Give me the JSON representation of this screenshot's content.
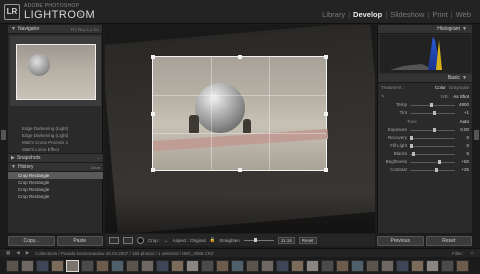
{
  "app": {
    "brand_small": "ADOBE PHOTOSHOP",
    "brand_big": "LIGHTROOM",
    "version": "3",
    "logo": "LR"
  },
  "modules": [
    "Library",
    "Develop",
    "Slideshow",
    "Print",
    "Web"
  ],
  "active_module": "Develop",
  "left_panel": {
    "navigator_title": "Navigator",
    "navigator_zoom": [
      "FIT",
      "FILL",
      "1:1",
      "3:1"
    ],
    "presets": [
      "Edge Darkening (Light)",
      "Edge Darkening (Light)",
      "Matt's Cross Process 1",
      "Matt's Lomo Effect"
    ],
    "snapshots_title": "Snapshots",
    "history_title": "History",
    "history_clear": "Clear",
    "history_items": [
      "Crop Rectangle",
      "Crop Rectangle",
      "Crop Rectangle",
      "Crop Rectangle"
    ],
    "copy_label": "Copy...",
    "paste_label": "Paste"
  },
  "right_panel": {
    "histogram_title": "Histogram",
    "basic_title": "Basic",
    "treatment_label": "Treatment :",
    "treatment_color": "Color",
    "treatment_gray": "Grayscale",
    "wb_label": "WB :",
    "wb_value": "As Shot",
    "temp_label": "Temp",
    "temp_value": "4800",
    "tint_label": "Tint",
    "tint_value": "+1",
    "tone_label": "Tone",
    "tone_auto": "Auto",
    "sliders": [
      {
        "label": "Exposure",
        "value": "0.00"
      },
      {
        "label": "Recovery",
        "value": "0"
      },
      {
        "label": "Fill Light",
        "value": "0"
      },
      {
        "label": "Blacks",
        "value": "5"
      },
      {
        "label": "Brightness",
        "value": "+50"
      },
      {
        "label": "Contrast",
        "value": "+25"
      }
    ],
    "previous_label": "Previous",
    "reset_label": "Reset"
  },
  "toolbar": {
    "crop_label": "Crop :",
    "aspect_label": "Aspect : Original",
    "straighten_label": "Straighten",
    "angle_value": "11.16",
    "reset_label": "Reset"
  },
  "filmbar": {
    "path_text": "Collections / Parada kosmonautow 26.04.2007 / 155 photos / 1 selected / IMG_4085.CR2",
    "filter_label": "Filter :",
    "page_nums": [
      "1",
      "2"
    ]
  },
  "filmstrip_count": 31,
  "filmstrip_selected": 4
}
